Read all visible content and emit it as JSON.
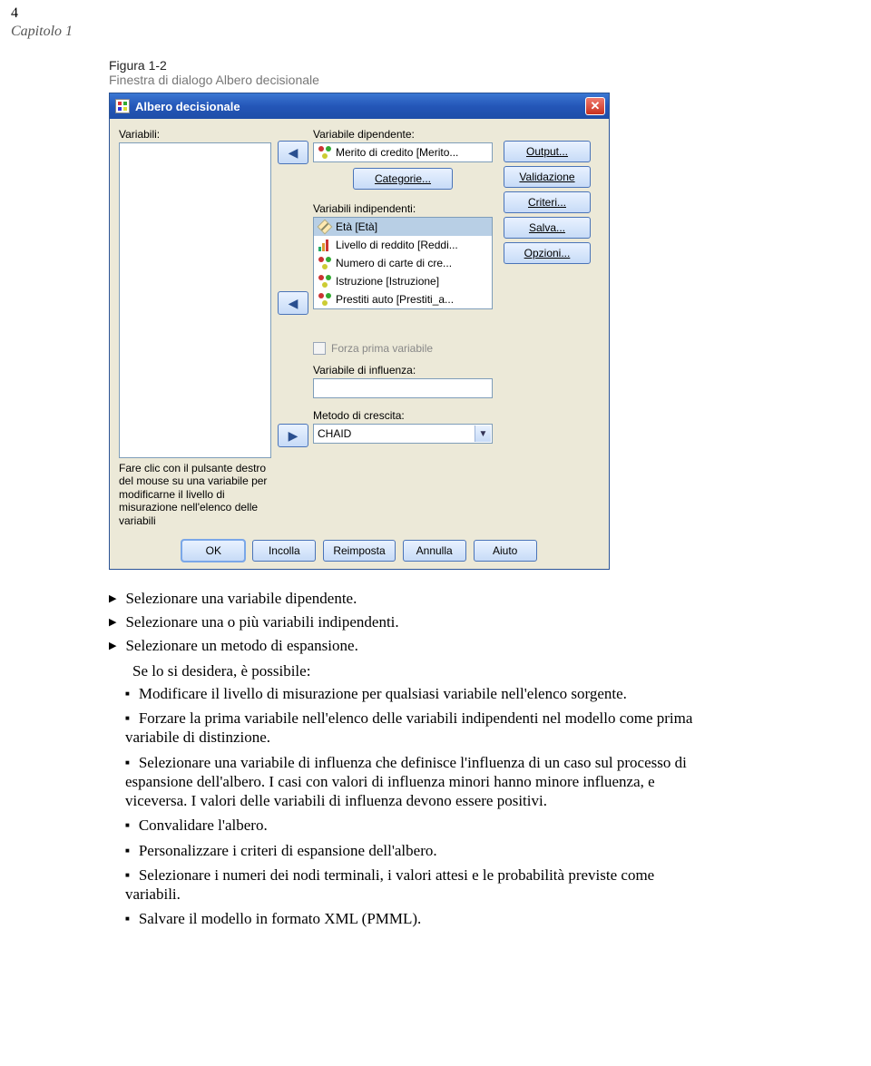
{
  "page": {
    "number": "4",
    "chapter": "Capitolo 1",
    "figure_label": "Figura 1-2",
    "figure_caption": "Finestra di dialogo Albero decisionale"
  },
  "dialog": {
    "title": "Albero decisionale",
    "labels": {
      "variables": "Variabili:",
      "dependent": "Variabile dipendente:",
      "categories_btn": "Categorie...",
      "independent": "Variabili indipendenti:",
      "force_first": "Forza prima variabile",
      "influence": "Variabile di influenza:",
      "method": "Metodo di crescita:"
    },
    "dependent_value": "Merito di credito [Merito...",
    "independent_items": [
      {
        "icon": "scale",
        "label": "Età [Età]"
      },
      {
        "icon": "ordinal",
        "label": "Livello di reddito [Reddi..."
      },
      {
        "icon": "nominal",
        "label": "Numero di carte di cre..."
      },
      {
        "icon": "nominal",
        "label": "Istruzione [Istruzione]"
      },
      {
        "icon": "nominal",
        "label": "Prestiti auto [Prestiti_a..."
      }
    ],
    "method_value": "CHAID",
    "side_buttons": {
      "output": "Output...",
      "validation": "Validazione",
      "criteria": "Criteri...",
      "save": "Salva...",
      "options": "Opzioni..."
    },
    "hint": "Fare clic con il pulsante destro del mouse su una variabile per modificarne il livello di misurazione nell'elenco delle variabili",
    "buttons": {
      "ok": "OK",
      "paste": "Incolla",
      "reset": "Reimposta",
      "cancel": "Annulla",
      "help": "Aiuto"
    }
  },
  "instructions": {
    "steps": [
      "Selezionare una variabile dipendente.",
      "Selezionare una o più variabili indipendenti.",
      "Selezionare un metodo di espansione."
    ],
    "optional_intro": "Se lo si desidera, è possibile:",
    "optional": [
      "Modificare il livello di misurazione per qualsiasi variabile nell'elenco sorgente.",
      "Forzare la prima variabile nell'elenco delle variabili indipendenti nel modello come prima variabile di distinzione.",
      "Selezionare una variabile di influenza che definisce l'influenza di un caso sul processo di espansione dell'albero. I casi con valori di influenza minori hanno minore influenza, e viceversa. I valori delle variabili di influenza devono essere positivi.",
      "Convalidare l'albero.",
      "Personalizzare i criteri di espansione dell'albero.",
      "Selezionare i numeri dei nodi terminali, i valori attesi e le probabilità previste come variabili.",
      "Salvare il modello in formato XML (PMML)."
    ]
  }
}
